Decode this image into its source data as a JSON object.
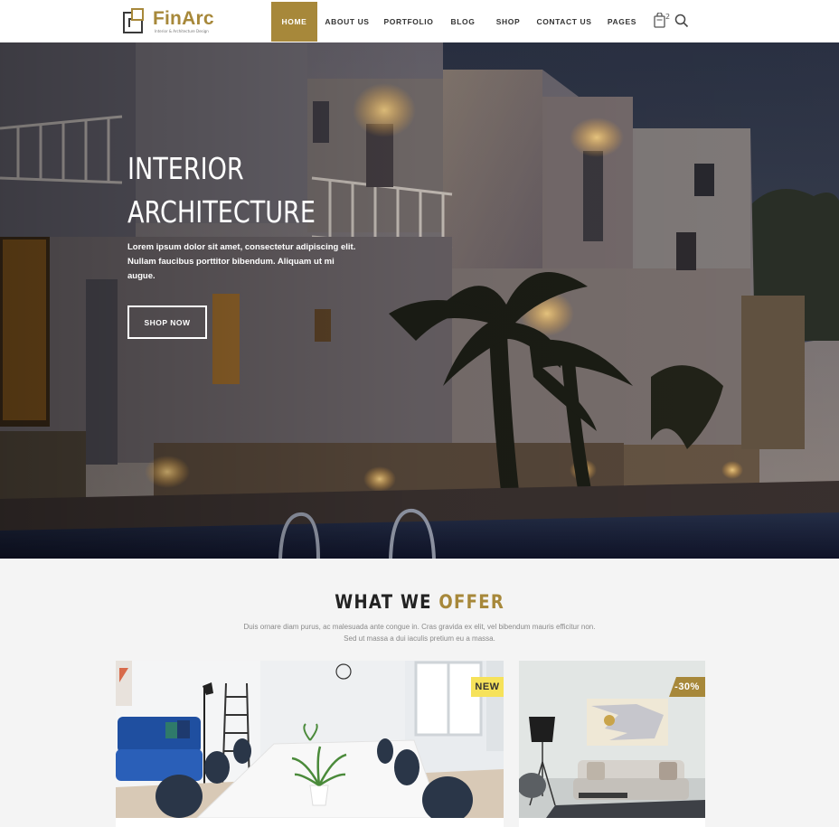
{
  "brand": {
    "name": "FinArc",
    "tagline": "Interior & Architecture Design",
    "accent_color": "#a7883a"
  },
  "nav": {
    "items": [
      "Home",
      "About Us",
      "Portfolio",
      "Blog",
      "Shop",
      "Contact Us",
      "Pages"
    ],
    "active": "Home"
  },
  "header_icons": {
    "cart_icon": "shopping-bag-icon",
    "cart_count": "2",
    "search_icon": "search-icon"
  },
  "hero": {
    "title_line1": "INTERIOR",
    "title_line2": "ARCHITECTURE",
    "text": "Lorem ipsum dolor sit amet, consectetur adipiscing elit. Nullam faucibus porttitor bibendum. Aliquam ut mi augue.",
    "button": "Shop Now"
  },
  "offer": {
    "title_plain": "WHAT WE",
    "title_accent": "OFFER",
    "desc_line1": "Duis ornare diam purus, ac malesuada ante congue in. Cras gravida ex elit, vel bibendum mauris efficitur non.",
    "desc_line2": "Sed ut massa a dui iaculis pretium eu a massa."
  },
  "cards": [
    {
      "badge": "NEW",
      "badge_color": "#f6e25a"
    },
    {
      "badge": "-30%",
      "badge_color": "#a7883a"
    }
  ]
}
